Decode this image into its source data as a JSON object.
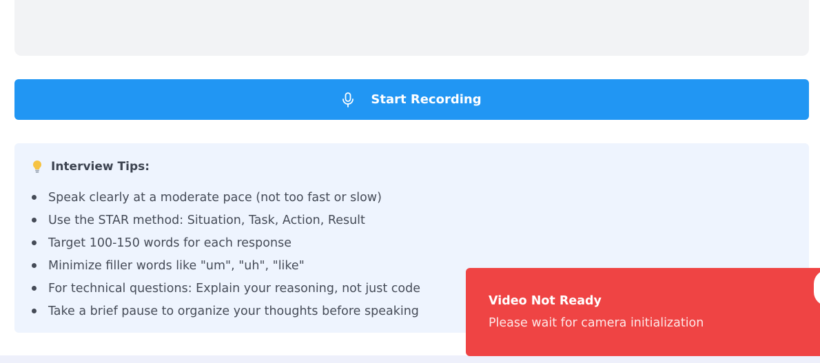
{
  "record_button": {
    "label": "Start Recording",
    "icon": "microphone-icon",
    "color": "#2196f3"
  },
  "tips": {
    "icon": "lightbulb-icon",
    "title": "Interview Tips:",
    "items": [
      "Speak clearly at a moderate pace (not too fast or slow)",
      "Use the STAR method: Situation, Task, Action, Result",
      "Target 100-150 words for each response",
      "Minimize filler words like \"um\", \"uh\", \"like\"",
      "For technical questions: Explain your reasoning, not just code",
      "Take a brief pause to organize your thoughts before speaking"
    ]
  },
  "toast": {
    "title": "Video Not Ready",
    "message": "Please wait for camera initialization",
    "color": "#ef4444"
  }
}
